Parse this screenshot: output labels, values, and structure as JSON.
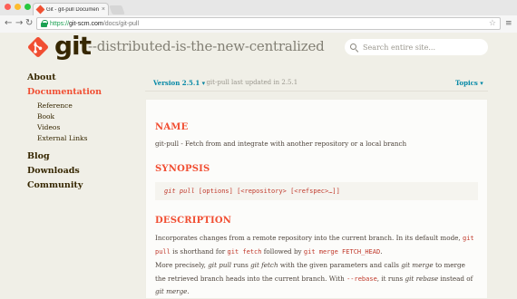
{
  "browser": {
    "tab_title": "Git - git-pull Documentation",
    "tab_close": "×",
    "url_scheme": "https://",
    "url_host": "git-scm.com",
    "url_path": "/docs/git-pull",
    "back_glyph": "←",
    "forward_glyph": "→",
    "reload_glyph": "↻",
    "star_glyph": "☆",
    "menu_glyph": "≡",
    "traffic_lights": [
      "#fd5f57",
      "#fdbc2e",
      "#28c840"
    ]
  },
  "header": {
    "logo_text": "git",
    "tagline": "--distributed-is-the-new-centralized",
    "search_placeholder": "Search entire site...",
    "brand_color": "#f14e32"
  },
  "sidebar": {
    "items": [
      {
        "label": "About",
        "active": false
      },
      {
        "label": "Documentation",
        "active": true
      },
      {
        "label": "Blog",
        "active": false
      },
      {
        "label": "Downloads",
        "active": false
      },
      {
        "label": "Community",
        "active": false
      }
    ],
    "subitems": [
      "Reference",
      "Book",
      "Videos",
      "External Links"
    ]
  },
  "version_bar": {
    "version_label": "Version 2.5.1 ▾",
    "updated_text": "·  git-pull last updated in 2.5.1",
    "topics_label": "Topics ▾"
  },
  "content": {
    "name_heading": "NAME",
    "name_text": "git-pull - Fetch from and integrate with another repository or a local branch",
    "synopsis_heading": "SYNOPSIS",
    "synopsis_cmd": "git pull",
    "synopsis_args": " [options] [<repository> [<refspec>…​]]",
    "description_heading": "DESCRIPTION",
    "desc1_a": "Incorporates changes from a remote repository into the current branch. In its default mode, ",
    "desc1_code1": "git pull",
    "desc1_b": " is shorthand for ",
    "desc1_code2": "git fetch",
    "desc1_c": " followed by ",
    "desc1_code3": "git merge FETCH_HEAD",
    "desc1_d": ".",
    "desc2_a": "More precisely, ",
    "desc2_em1": "git pull",
    "desc2_b": " runs ",
    "desc2_em2": "git fetch",
    "desc2_c": " with the given parameters and calls ",
    "desc2_em3": "git merge",
    "desc2_d": " to merge the retrieved branch heads into the current branch. With ",
    "desc2_code1": "--rebase",
    "desc2_e": ", it runs ",
    "desc2_em4": "git rebase",
    "desc2_f": " instead of ",
    "desc2_em5": "git merge",
    "desc2_g": "."
  }
}
